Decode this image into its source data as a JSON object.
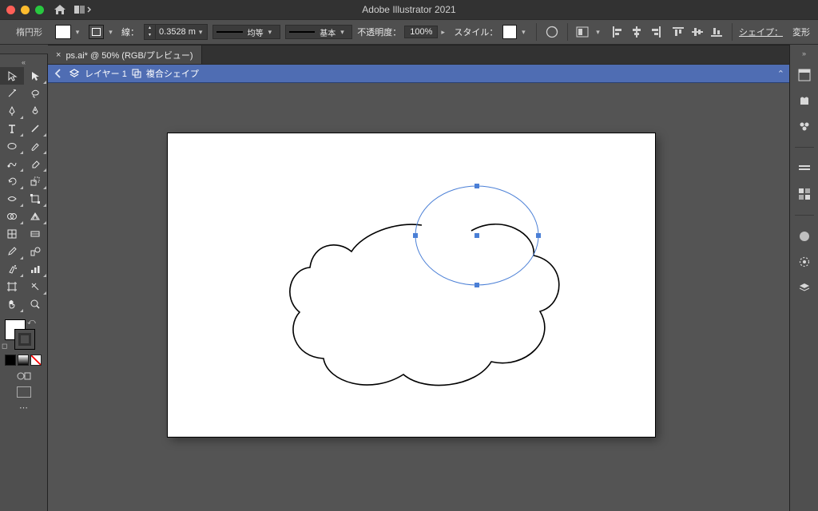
{
  "app": {
    "title": "Adobe Illustrator 2021"
  },
  "controlbar": {
    "tool_name": "楕円形",
    "stroke_label": "線：",
    "stroke_width": "0.3528 m",
    "variable_label": "均等",
    "brush_label": "基本",
    "opacity_label": "不透明度：",
    "opacity_value": "100%",
    "style_label": "スタイル：",
    "shape_link": "シェイプ：",
    "transform_label": "変形"
  },
  "doc_tab": {
    "label": "ps.ai* @ 50% (RGB/プレビュー)"
  },
  "layer_path": {
    "layer": "レイヤー 1",
    "object": "複合シェイプ"
  },
  "icons": {
    "home": "home-icon",
    "layout": "layout-switch-icon",
    "globe": "document-setup-icon",
    "prefs": "preferences-icon"
  }
}
